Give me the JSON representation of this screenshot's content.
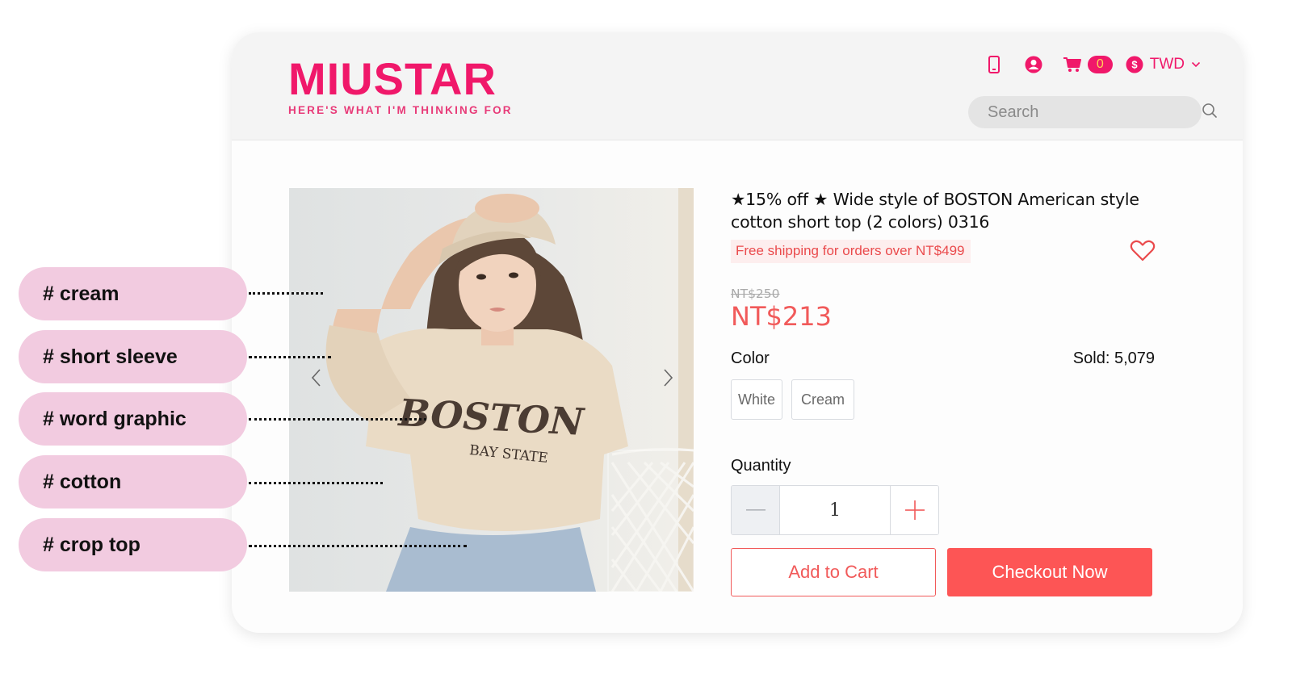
{
  "brand": {
    "name": "MIUSTAR",
    "tagline": "HERE'S WHAT I'M THINKING FOR",
    "color": "#f0186a"
  },
  "header": {
    "icons": [
      "phone-icon",
      "account-icon",
      "cart-icon",
      "currency-icon",
      "chevron-down-icon"
    ],
    "cart_count": "0",
    "currency": "TWD",
    "search": {
      "placeholder": "Search",
      "value": ""
    }
  },
  "product": {
    "title": "★15% off ★ Wide style of BOSTON American style cotton short top (2 colors) 0316",
    "shipping_note": "Free shipping for orders over NT$499",
    "original_price": "NT$250",
    "price": "NT$213",
    "color_label": "Color",
    "sold": "Sold: 5,079",
    "colors": [
      "White",
      "Cream"
    ],
    "quantity_label": "Quantity",
    "quantity": "1",
    "add_to_cart": "Add to Cart",
    "checkout": "Checkout Now",
    "image_alt": "Woman wearing cream BOSTON BAY STATE cropped t-shirt and cap",
    "accent_color": "#f15a5a"
  },
  "tags": [
    {
      "label": "# cream"
    },
    {
      "label": "# short sleeve"
    },
    {
      "label": "# word graphic"
    },
    {
      "label": "# cotton"
    },
    {
      "label": "# crop top"
    }
  ],
  "tag_color": "#f2cbe0"
}
